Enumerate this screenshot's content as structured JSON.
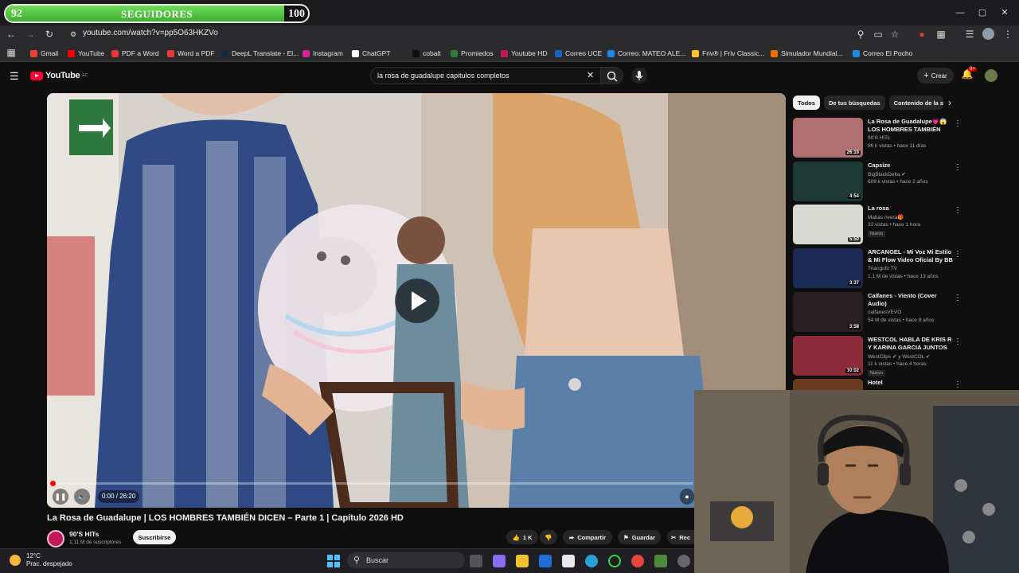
{
  "overlay": {
    "left_value": "92",
    "center_label": "SEGUIDORES",
    "right_value": "100",
    "progress_fraction": 0.92
  },
  "browser": {
    "url": "youtube.com/watch?v=pp5O63HKZVo",
    "bookmarks": [
      {
        "label": "Gmail",
        "color": "#ea4335"
      },
      {
        "label": "YouTube",
        "color": "#ff0000"
      },
      {
        "label": "PDF a Word",
        "color": "#e53935"
      },
      {
        "label": "Word a PDF",
        "color": "#e53935"
      },
      {
        "label": "DeepL Translate - El...",
        "color": "#0f2b46"
      },
      {
        "label": "Instagram",
        "color": "#d6249f"
      },
      {
        "label": "ChatGPT",
        "color": "#ffffff"
      },
      {
        "label": "cobalt",
        "color": "#111111"
      },
      {
        "label": "Promiedos",
        "color": "#2e7d32"
      },
      {
        "label": "Youtube HD",
        "color": "#c2185b"
      },
      {
        "label": "Correo UCE",
        "color": "#1565c0"
      },
      {
        "label": "Correo: MATEO ALE...",
        "color": "#1e88e5"
      },
      {
        "label": "Friv® | Friv Classic...",
        "color": "#fbc02d"
      },
      {
        "label": "Simulador Mundial...",
        "color": "#ef6c00"
      },
      {
        "label": "Correo El Pocho",
        "color": "#1e88e5"
      }
    ]
  },
  "youtube": {
    "logo_text": "YouTube",
    "logo_region": "EC",
    "search_query": "la rosa de guadalupe capitulos completos",
    "create_label": "Crear",
    "notif_badge": "9+"
  },
  "player": {
    "time": "0:00 / 26:20",
    "progress_fraction": 0.0,
    "title": "La Rosa de Guadalupe | LOS HOMBRES TAMBIÉN DICEN – Parte 1 | Capítulo 2026 HD",
    "channel": "90'S HITs",
    "subscribers": "1.11 M de suscriptores",
    "subscribe_label": "Suscribirse",
    "likes": "1 K",
    "share_label": "Compartir",
    "save_label": "Guardar",
    "clip_label": "Rec"
  },
  "sidebar": {
    "chips": [
      "Todos",
      "De tus búsquedas",
      "Contenido de la se"
    ],
    "videos": [
      {
        "title": "La Rosa de Guadalupe💗😱 LOS HOMBRES TAMBIÉN DICE...",
        "channel": "90'S HITs",
        "meta": "86 k vistas • hace 11 días",
        "duration": "26:19",
        "thumb": "#b07070",
        "badge": ""
      },
      {
        "title": "Capsize",
        "channel": "BigBlackDelta ✔",
        "meta": "608 k vistas • hace 2 años",
        "duration": "4:54",
        "thumb": "#1d3b34",
        "badge": ""
      },
      {
        "title": "La rosa",
        "channel": "Matias rivera🎁",
        "meta": "32 vistas • hace 1 hora",
        "duration": "5:50",
        "thumb": "#d9d9d4",
        "badge": "Nuevo"
      },
      {
        "title": "ARCANGEL - Mi Voz Mi Estilo & Mi Flow Video Oficial By BB Inc",
        "channel": "Triangulo TV",
        "meta": "1.1 M de vistas • hace 13 años",
        "duration": "3:37",
        "thumb": "#1a2a55",
        "badge": ""
      },
      {
        "title": "Caifanes - Viento (Cover Audio)",
        "channel": "caifanesVEVO",
        "meta": "54 M de vistas • hace 8 años",
        "duration": "3:58",
        "thumb": "#2a1f22",
        "badge": ""
      },
      {
        "title": "WESTCOL HABLA DE KRIS R Y KARINA GARCIA JUNTOS",
        "channel": "WestClips ✔ y WestCOL ✔",
        "meta": "11 k vistas • hace 4 horas",
        "duration": "10:02",
        "thumb": "#8c2b3a",
        "badge": "Nuevo"
      },
      {
        "title": "Hotel",
        "channel": "",
        "meta": "",
        "duration": "",
        "thumb": "#6b3a1e",
        "badge": ""
      }
    ]
  },
  "taskbar": {
    "temperature": "12°C",
    "condition": "Prac. despejado",
    "search_label": "Buscar"
  }
}
